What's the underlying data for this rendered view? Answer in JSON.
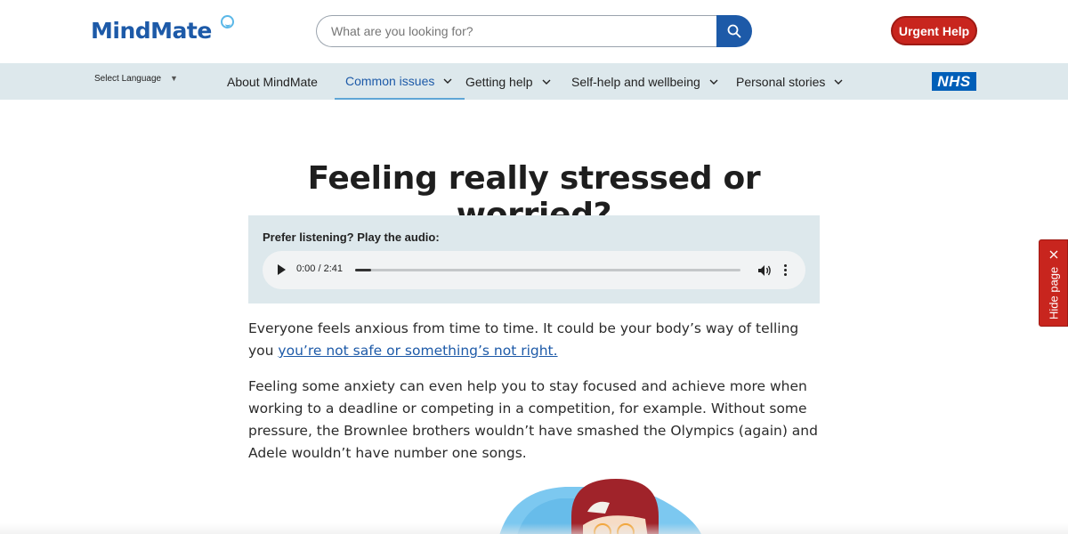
{
  "header": {
    "logo_text": "MindMate",
    "search_placeholder": "What are you looking for?",
    "search_value": "",
    "urgent_label": "Urgent Help"
  },
  "nav": {
    "language_label": "Select Language",
    "items": [
      {
        "label": "About MindMate",
        "dropdown": false
      },
      {
        "label": "Common issues",
        "dropdown": true,
        "active": true
      },
      {
        "label": "Getting help",
        "dropdown": true
      },
      {
        "label": "Self-help and wellbeing",
        "dropdown": true
      },
      {
        "label": "Personal stories",
        "dropdown": true
      }
    ],
    "nhs_logo": "NHS"
  },
  "page": {
    "title": "Feeling really stressed or worried?",
    "audio": {
      "label": "Prefer listening? Play the audio:",
      "time": "0:00 / 2:41",
      "progress": 0
    },
    "para1_text": "Everyone feels anxious from time to time. It could be your body’s way of telling you ",
    "para1_link": "you’re not safe or something’s not right.",
    "para2": "Feeling some anxiety can even help you to stay focused and achieve more when working to a deadline or competing in a competition, for example. Without some pressure, the Brownlee brothers wouldn’t have smashed the Olympics (again) and Adele wouldn’t have number one songs."
  },
  "hide_tab": {
    "label": "Hide page"
  },
  "colors": {
    "brand_blue": "#1d5aa8",
    "urgent_red": "#c8251e",
    "nav_bg": "#dde8ec",
    "nhs_blue": "#005eb8"
  },
  "icons": [
    "search-icon",
    "chevron-down-icon",
    "play-icon",
    "volume-icon",
    "more-vertical-icon",
    "close-icon"
  ]
}
